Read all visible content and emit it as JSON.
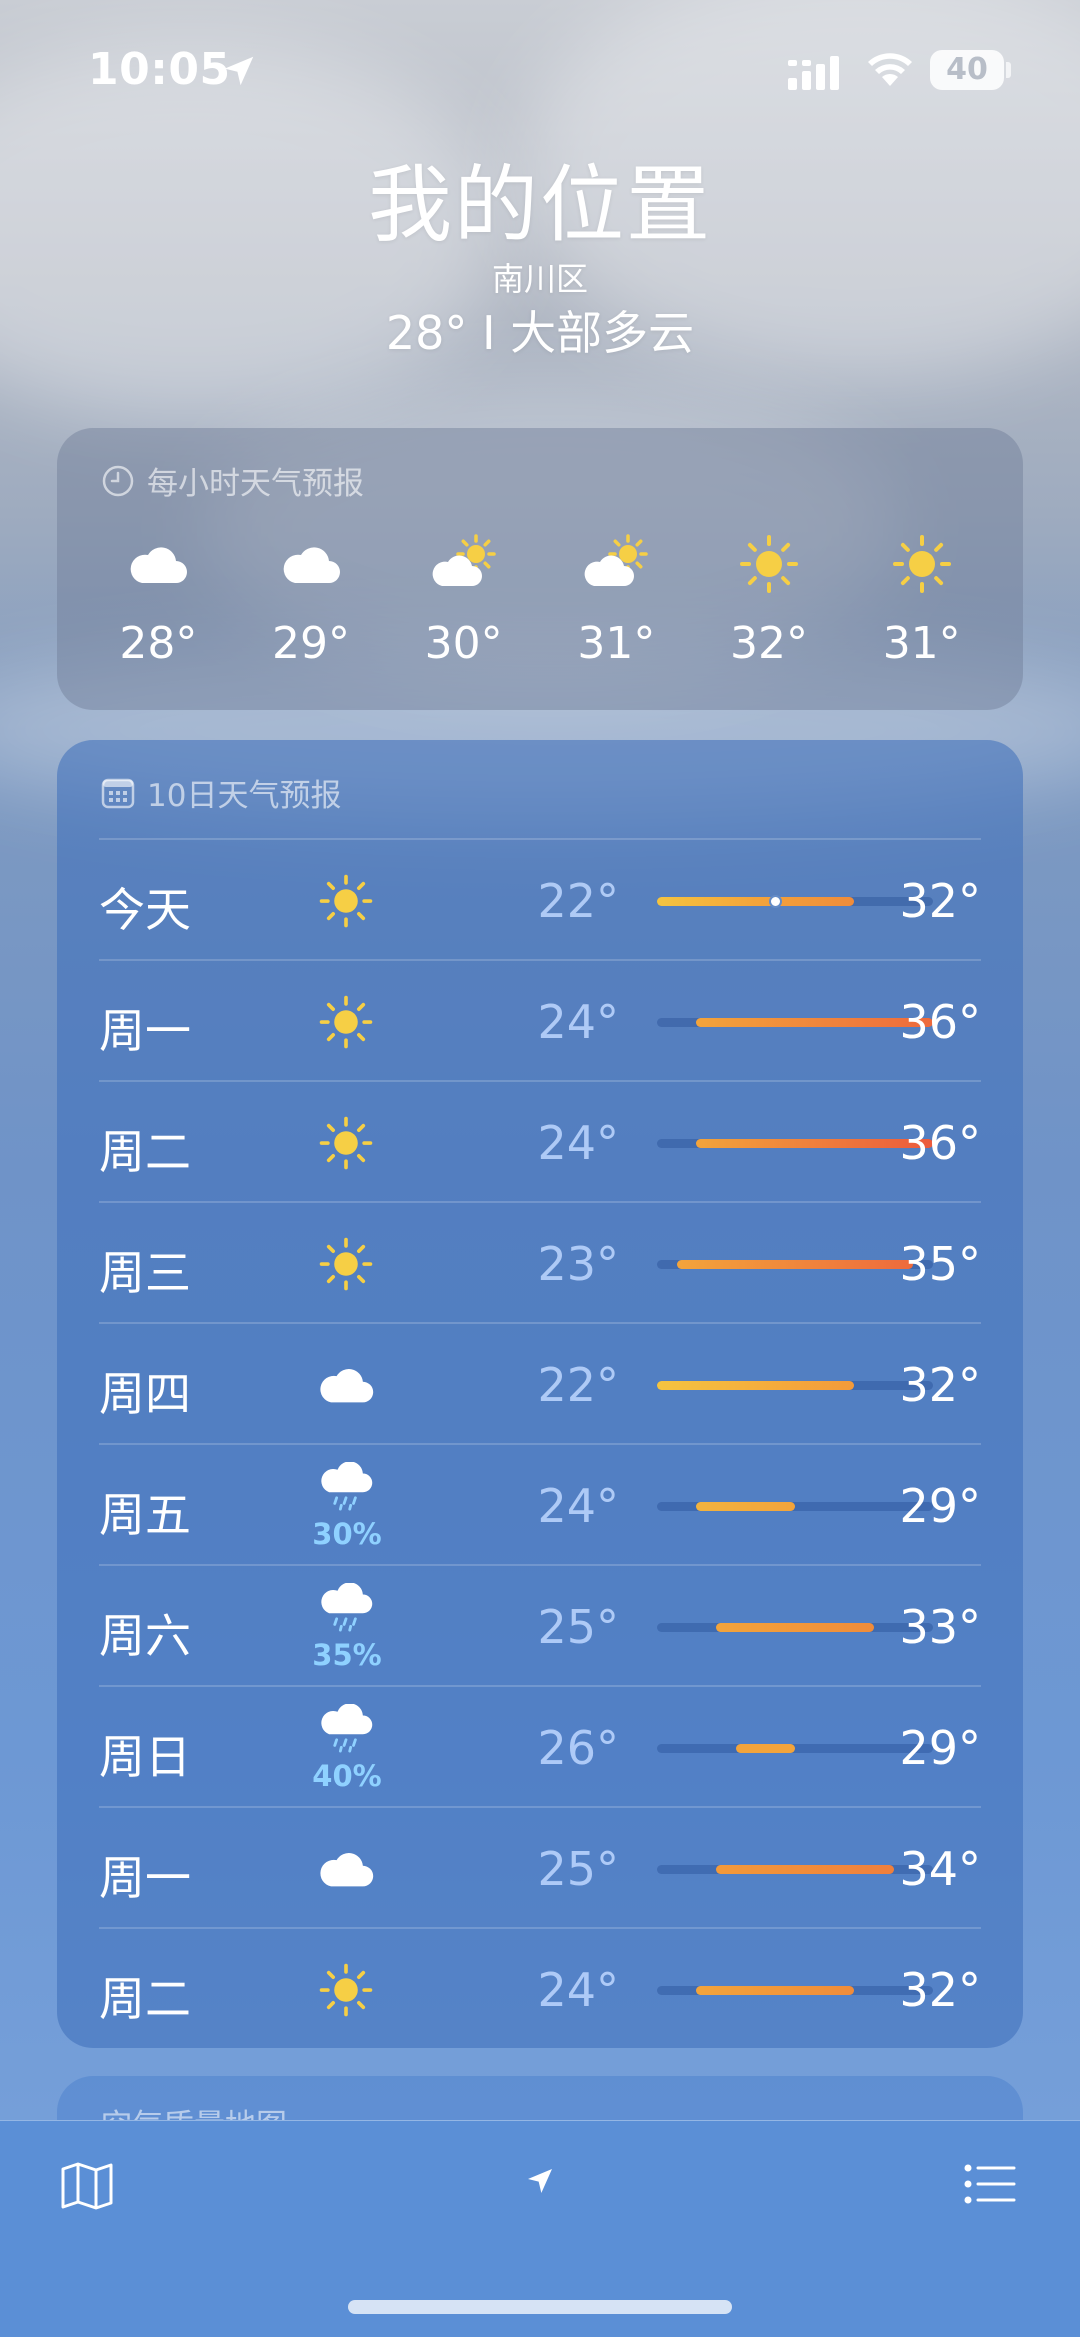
{
  "status_bar": {
    "time": "10:05",
    "battery": "40"
  },
  "header": {
    "city": "我的位置",
    "district": "南川区",
    "summary": "28° Ⅰ 大部多云"
  },
  "hourly": {
    "title": "每小时天气预报",
    "items": [
      {
        "icon": "cloud-icon",
        "temp": "28°"
      },
      {
        "icon": "cloud-icon",
        "temp": "29°"
      },
      {
        "icon": "partly-cloudy-icon",
        "temp": "30°"
      },
      {
        "icon": "partly-cloudy-icon",
        "temp": "31°"
      },
      {
        "icon": "sun-icon",
        "temp": "32°"
      },
      {
        "icon": "sun-icon",
        "temp": "31°"
      }
    ]
  },
  "daily": {
    "title": "10日天气预报",
    "range_scale": {
      "min": 22,
      "max": 36
    },
    "days": [
      {
        "day": "今天",
        "icon": "sun-icon",
        "low": "22°",
        "high": "32°",
        "range": [
          22,
          32
        ],
        "current": 28,
        "colors": [
          "#f5c440",
          "#f3a43b",
          "#f08c3a"
        ]
      },
      {
        "day": "周一",
        "icon": "sun-icon",
        "low": "24°",
        "high": "36°",
        "range": [
          24,
          36
        ],
        "colors": [
          "#f3a43b",
          "#ee6a3c"
        ]
      },
      {
        "day": "周二",
        "icon": "sun-icon",
        "low": "24°",
        "high": "36°",
        "range": [
          24,
          36
        ],
        "colors": [
          "#f3a43b",
          "#ec5a3c"
        ]
      },
      {
        "day": "周三",
        "icon": "sun-icon",
        "low": "23°",
        "high": "35°",
        "range": [
          23,
          35
        ],
        "colors": [
          "#f3a43b",
          "#ee6a3c"
        ]
      },
      {
        "day": "周四",
        "icon": "cloud-icon",
        "low": "22°",
        "high": "32°",
        "range": [
          22,
          32
        ],
        "colors": [
          "#f5c440",
          "#f39a3a"
        ]
      },
      {
        "day": "周五",
        "icon": "rain-icon",
        "pop": "30%",
        "low": "24°",
        "high": "29°",
        "range": [
          24,
          29
        ],
        "colors": [
          "#f3b33e",
          "#f3a43b"
        ]
      },
      {
        "day": "周六",
        "icon": "rain-icon",
        "pop": "35%",
        "low": "25°",
        "high": "33°",
        "range": [
          25,
          33
        ],
        "colors": [
          "#f3a43b",
          "#f08c3a"
        ]
      },
      {
        "day": "周日",
        "icon": "rain-icon",
        "pop": "40%",
        "low": "26°",
        "high": "29°",
        "range": [
          26,
          29
        ],
        "colors": [
          "#f3a43b",
          "#f3a43b"
        ]
      },
      {
        "day": "周一",
        "icon": "cloud-icon",
        "low": "25°",
        "high": "34°",
        "range": [
          25,
          34
        ],
        "colors": [
          "#f39a3a",
          "#f07f3b"
        ]
      },
      {
        "day": "周二",
        "icon": "sun-icon",
        "low": "24°",
        "high": "32°",
        "range": [
          24,
          32
        ],
        "colors": [
          "#f3a43b",
          "#f08c3a"
        ]
      }
    ]
  },
  "air_quality": {
    "title": "空气质量地图"
  },
  "toolbar": {
    "left": "map-icon",
    "center": "location-arrow-icon",
    "right": "list-icon"
  }
}
